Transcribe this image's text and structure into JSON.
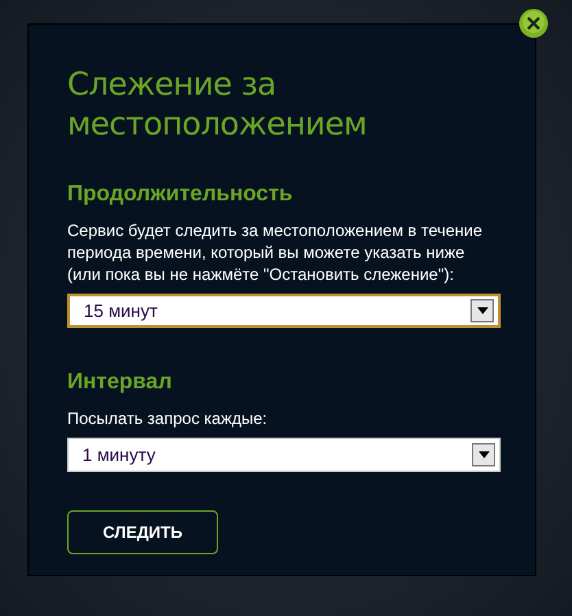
{
  "dialog": {
    "title": "Слежение за местоположением",
    "sections": [
      {
        "heading": "Продолжительность",
        "description": "Сервис будет следить за местоположением в течение периода времени, который вы можете указать ниже (или пока вы не нажмёте \"Остановить слежение\"):",
        "select": {
          "value": "15 минут",
          "focused": true
        }
      },
      {
        "heading": "Интервал",
        "description": "Посылать запрос каждые:",
        "select": {
          "value": "1 минуту",
          "focused": false
        }
      }
    ],
    "button": "СЛЕДИТЬ"
  }
}
